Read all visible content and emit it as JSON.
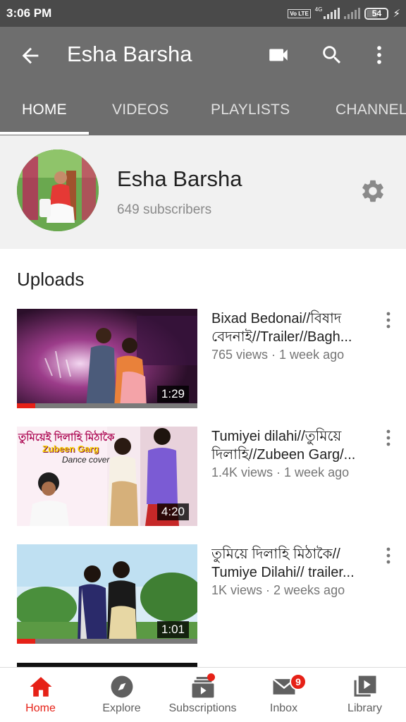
{
  "status_bar": {
    "time": "3:06 PM",
    "volte": "Vo LTE",
    "network": "4G",
    "battery": "54"
  },
  "app_bar": {
    "title": "Esha Barsha",
    "icons": [
      "back-arrow-icon",
      "video-camera-icon",
      "search-icon",
      "more-vert-icon"
    ]
  },
  "tabs": [
    {
      "label": "HOME",
      "active": true
    },
    {
      "label": "VIDEOS",
      "active": false
    },
    {
      "label": "PLAYLISTS",
      "active": false
    },
    {
      "label": "CHANNEL",
      "active": false
    }
  ],
  "channel": {
    "name": "Esha Barsha",
    "subscribers": "649 subscribers"
  },
  "uploads": {
    "heading": "Uploads",
    "videos": [
      {
        "title_line1": "Bixad Bedonai//বিষাদ",
        "title_line2": "বেদনাই//Trailer//Bagh...",
        "meta": "765 views · 1 week ago",
        "duration": "1:29",
        "watched": 0.1
      },
      {
        "title_line1": "Tumiyei dilahi//তুমিয়ে",
        "title_line2": "দিলাহি//Zubeen Garg/...",
        "meta": "1.4K views · 1 week ago",
        "duration": "4:20",
        "watched": 0
      },
      {
        "title_line1": "তুমিয়ে দিলাহি মিঠাকৈ//",
        "title_line2": "Tumiye Dilahi// trailer...",
        "meta": "1K views · 2 weeks ago",
        "duration": "1:01",
        "watched": 0.1
      }
    ],
    "thumb2_text": {
      "bengali": "তুমিয়েই দিলাহি মিঠাকৈ",
      "artist": "Zubeen Garg",
      "note": "Dance cover"
    }
  },
  "bottom_nav": [
    {
      "label": "Home",
      "icon": "home-icon",
      "active": true
    },
    {
      "label": "Explore",
      "icon": "explore-compass-icon",
      "active": false
    },
    {
      "label": "Subscriptions",
      "icon": "subscriptions-icon",
      "active": false,
      "dot": true
    },
    {
      "label": "Inbox",
      "icon": "inbox-mail-icon",
      "active": false,
      "badge": "9"
    },
    {
      "label": "Library",
      "icon": "library-icon",
      "active": false
    }
  ],
  "colors": {
    "app_bar": "#6e6e6e",
    "status_bar": "#4a4a4a",
    "accent_red": "#e62117"
  }
}
